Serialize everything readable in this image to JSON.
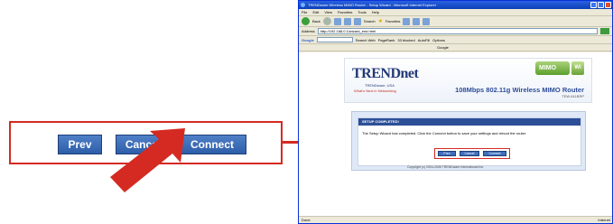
{
  "callout": {
    "buttons": [
      {
        "label": "Prev"
      },
      {
        "label": "Cancel"
      },
      {
        "label": "Connect"
      }
    ]
  },
  "browser": {
    "title": "TRENDware Wireless MIMO Router - Setup Wizard - Microsoft Internet Explorer",
    "menu": [
      "File",
      "Edit",
      "View",
      "Favorites",
      "Tools",
      "Help"
    ],
    "toolbar": {
      "back": "Back",
      "search": "Search",
      "favorites": "Favorites"
    },
    "address_label": "Address",
    "address_value": "http://192.168.0.1/wizard_end.html",
    "go": "Go",
    "google_label": "Google",
    "search_web": "Search Web",
    "pagerank": "PageRank",
    "blocked": "33 blocked",
    "autofill": "AutoFill",
    "options": "Options",
    "links_label": "Google",
    "status_left": "Done",
    "status_right": "Internet"
  },
  "page": {
    "logo": "TRENDnet",
    "logo_sub": "TRENDware, USA",
    "tagline": "What's Next in Networking",
    "badge": "MIMO",
    "wifi_badge": "Wi Fi",
    "product": "108Mbps 802.11g Wireless MIMO Router",
    "model": "TEW-611BRP",
    "panel_title": "SETUP COMPLETED!",
    "panel_text": "The Setup Wizard has completed. Click the Connect button to save your settings and reboot the router.",
    "mini_buttons": [
      "Prev",
      "Cancel",
      "Connect"
    ],
    "copyright": "Copyright (c) 2004-2005 TRENDware International Inc."
  },
  "colors": {
    "callout_red": "#d42a22",
    "button_blue": "#3f6fbc",
    "brand_navy": "#243a78"
  }
}
